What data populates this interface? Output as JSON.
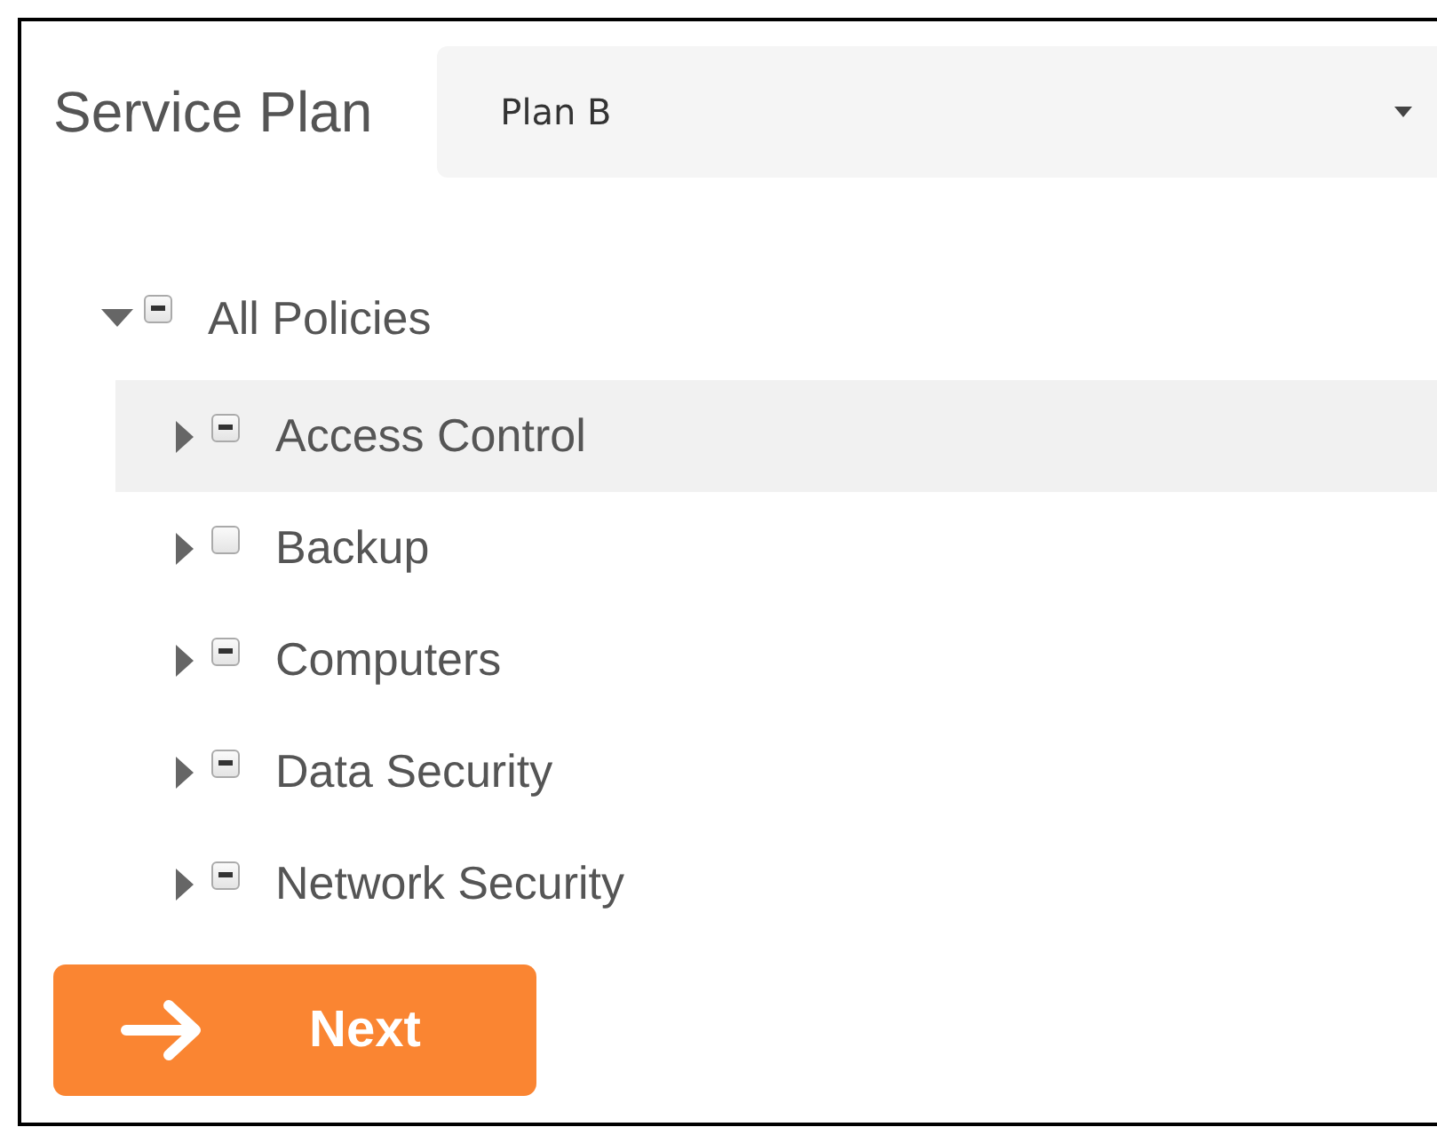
{
  "header": {
    "title": "Service Plan",
    "plan_select": {
      "value": "Plan B"
    }
  },
  "policy_tree": [
    {
      "label": "All Policies",
      "expanded": true,
      "indeterminate": true,
      "selected": false,
      "children": [
        {
          "label": "Access Control",
          "expanded": false,
          "indeterminate": true,
          "selected": true
        },
        {
          "label": "Backup",
          "expanded": false,
          "indeterminate": false,
          "selected": false
        },
        {
          "label": "Computers",
          "expanded": false,
          "indeterminate": true,
          "selected": false
        },
        {
          "label": "Data Security",
          "expanded": false,
          "indeterminate": true,
          "selected": false
        },
        {
          "label": "Network Security",
          "expanded": false,
          "indeterminate": true,
          "selected": false
        }
      ]
    }
  ],
  "next_button": {
    "label": "Next"
  }
}
